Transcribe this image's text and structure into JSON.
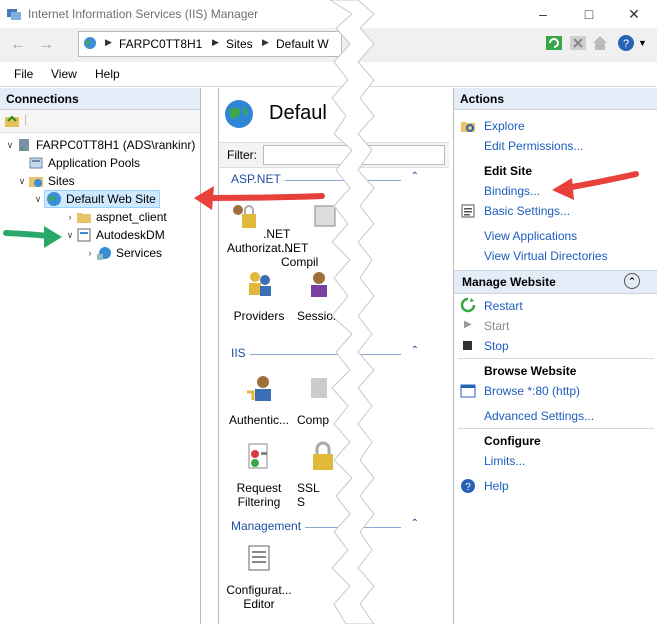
{
  "window": {
    "title": "Internet Information Services (IIS) Manager"
  },
  "address": {
    "segments": [
      "FARPC0TT8H1",
      "Sites",
      "Default W"
    ]
  },
  "menu": [
    "File",
    "View",
    "Help"
  ],
  "connections": {
    "header": "Connections",
    "tree": [
      {
        "label": "FARPC0TT8H1 (ADS\\rankinr)",
        "level": 0,
        "expanded": true
      },
      {
        "label": "Application Pools",
        "level": 1
      },
      {
        "label": "Sites",
        "level": 1,
        "expanded": true
      },
      {
        "label": "Default Web Site",
        "level": 2,
        "expanded": true,
        "selected": true
      },
      {
        "label": "aspnet_client",
        "level": 3
      },
      {
        "label": "AutodeskDM",
        "level": 3,
        "expanded": true
      },
      {
        "label": "Services",
        "level": 4
      }
    ]
  },
  "center": {
    "title": "Defaul",
    "filter_label": "Filter:",
    "groups": [
      {
        "name": "ASP.NET",
        "features": [
          ".NET Authorizat...",
          ".NET Compil",
          "Providers",
          "Session"
        ]
      },
      {
        "name": "IIS",
        "features": [
          "Authentic...",
          "Comp",
          "Request Filtering",
          "SSL S"
        ]
      },
      {
        "name": "Management",
        "features": [
          "Configurat... Editor"
        ]
      }
    ]
  },
  "actions": {
    "header": "Actions",
    "explore": "Explore",
    "edit_permissions": "Edit Permissions...",
    "edit_site": "Edit Site",
    "bindings": "Bindings...",
    "basic_settings": "Basic Settings...",
    "view_applications": "View Applications",
    "view_virtual_dirs": "View Virtual Directories",
    "manage_website": "Manage Website",
    "restart": "Restart",
    "start": "Start",
    "stop": "Stop",
    "browse_website": "Browse Website",
    "browse_80": "Browse *:80 (http)",
    "advanced_settings": "Advanced Settings...",
    "configure": "Configure",
    "limits": "Limits...",
    "help": "Help"
  },
  "colors": {
    "link": "#1c5dbf",
    "header_bg": "#e4ecf7",
    "arrow_red": "#e8403a",
    "arrow_green": "#2aa86a"
  }
}
